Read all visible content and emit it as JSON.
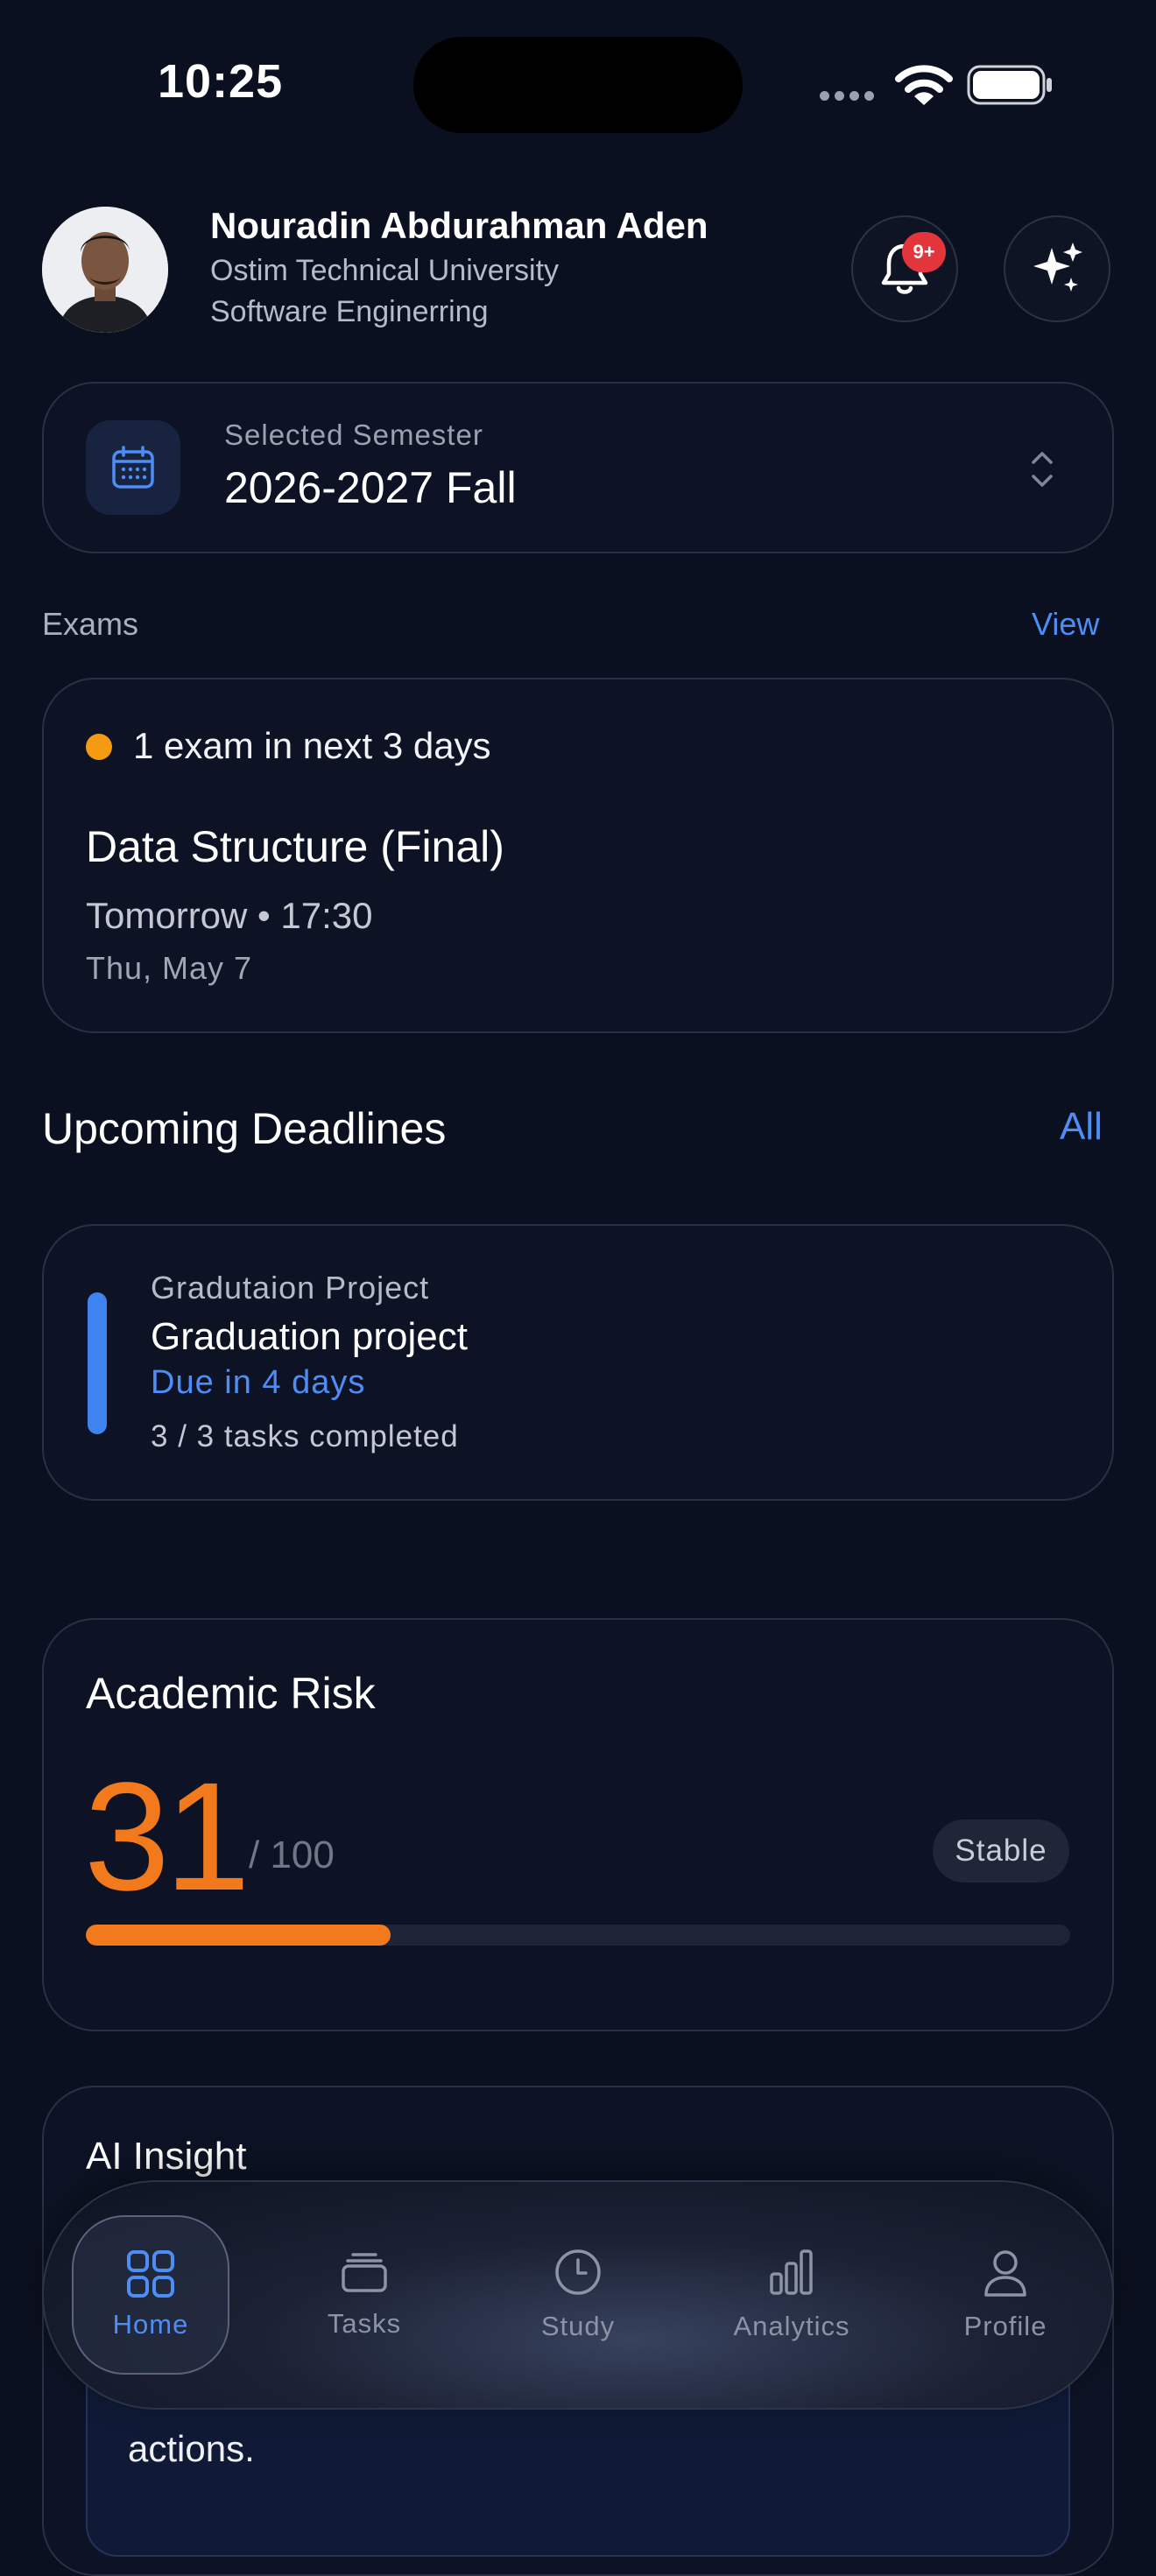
{
  "status_bar": {
    "time": "10:25"
  },
  "header": {
    "name": "Nouradin Abdurahman Aden",
    "university": "Ostim Technical University",
    "department": "Software Enginerring",
    "notification_badge": "9+"
  },
  "semester": {
    "label": "Selected Semester",
    "value": "2026-2027 Fall"
  },
  "exams": {
    "section_title": "Exams",
    "view_label": "View",
    "alert": "1 exam in next 3 days",
    "course": "Data Structure (Final)",
    "time": "Tomorrow • 17:30",
    "date": "Thu, May 7"
  },
  "deadlines": {
    "section_title": "Upcoming Deadlines",
    "all_label": "All",
    "items": [
      {
        "course": "Gradutaion Project",
        "title": "Graduation project",
        "due": "Due in 4 days",
        "progress": "3 / 3 tasks completed"
      }
    ]
  },
  "risk": {
    "title": "Academic Risk",
    "value": "31",
    "max": "/ 100",
    "percent": 31,
    "status": "Stable"
  },
  "insight": {
    "title": "AI Insight",
    "text_tail": "actions."
  },
  "tabs": [
    {
      "label": "Home",
      "icon": "grid-icon",
      "active": true
    },
    {
      "label": "Tasks",
      "icon": "stack-icon",
      "active": false
    },
    {
      "label": "Study",
      "icon": "clock-icon",
      "active": false
    },
    {
      "label": "Analytics",
      "icon": "bar-chart-icon",
      "active": false
    },
    {
      "label": "Profile",
      "icon": "person-icon",
      "active": false
    }
  ],
  "colors": {
    "background": "#0b1020",
    "accent_blue": "#4d8df5",
    "risk_orange": "#f27a1c",
    "warning_dot": "#f59a12",
    "badge_red": "#e5353c"
  }
}
